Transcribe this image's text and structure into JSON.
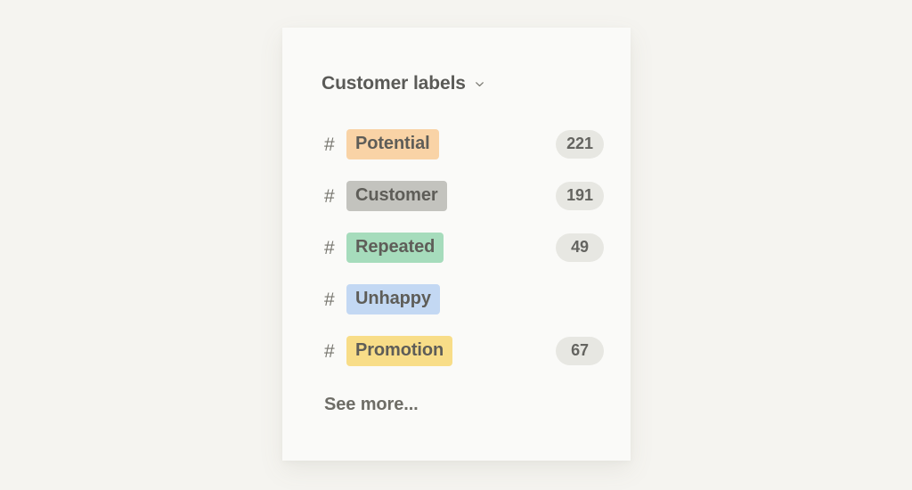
{
  "theme": {
    "page_background": "#f5f4f0",
    "card_background": "#fafaf8",
    "title_color": "#5a5a57",
    "badge_background": "#e7e7e2",
    "badge_text_color": "#646460",
    "hash_color": "#77766f",
    "tag_text_color": "#5e5d58"
  },
  "panel": {
    "title": "Customer labels",
    "collapse_icon": "chevron-down-icon",
    "see_more_label": "See more...",
    "labels": [
      {
        "hash": "#",
        "name": "Potential",
        "color": "#f9d3a6",
        "count": "221",
        "has_count": true
      },
      {
        "hash": "#",
        "name": "Customer",
        "color": "#c3c3be",
        "count": "191",
        "has_count": true
      },
      {
        "hash": "#",
        "name": "Repeated",
        "color": "#a6dcbc",
        "count": "49",
        "has_count": true
      },
      {
        "hash": "#",
        "name": "Unhappy",
        "color": "#c3d8f3",
        "count": "",
        "has_count": false
      },
      {
        "hash": "#",
        "name": "Promotion",
        "color": "#f8dd88",
        "count": "67",
        "has_count": true
      }
    ]
  }
}
